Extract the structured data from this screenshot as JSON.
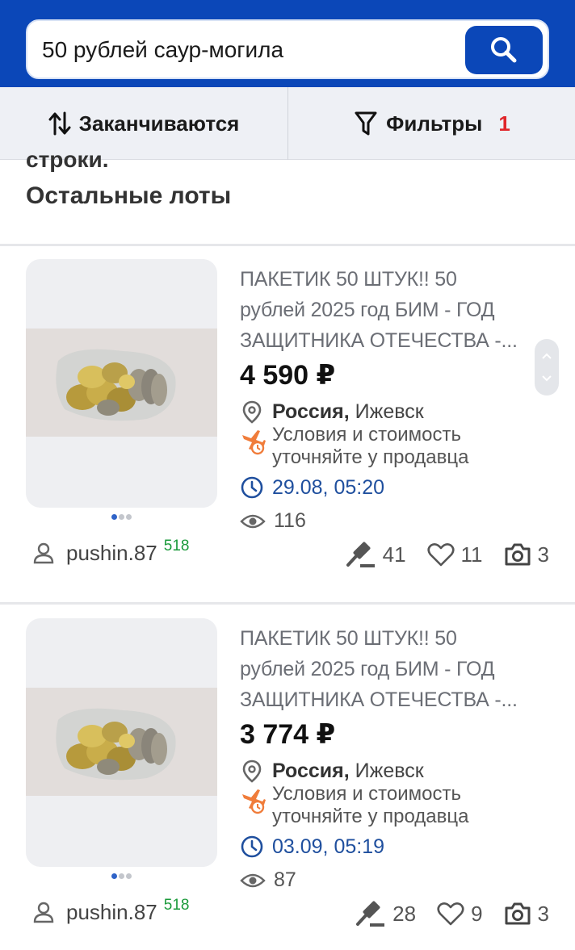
{
  "search": {
    "value": "50 рублей саур-могила"
  },
  "toolbar": {
    "sort_label": "Заканчиваются",
    "filter_label": "Фильтры",
    "filter_count": "1"
  },
  "cut_text": "строки.",
  "section_title": "Остальные лоты",
  "lots": [
    {
      "title_lines": [
        "ПАКЕТИК 50 ШТУК!!      50",
        "рублей 2025 год БИМ - ГОД",
        "ЗАЩИТНИКА ОТЕЧЕСТВА -..."
      ],
      "price": "4 590 ₽",
      "country": "Россия,",
      "city": "Ижевск",
      "shipping_line1": "Условия и стоимость",
      "shipping_line2": "уточняйте у продавца",
      "end_time": "29.08, 05:20",
      "views": "116",
      "seller": "pushin.87",
      "seller_rating": "518",
      "bids": "41",
      "favorites": "11",
      "photos": "3"
    },
    {
      "title_lines": [
        "ПАКЕТИК 50 ШТУК!!      50",
        "рублей 2025 год БИМ - ГОД",
        "ЗАЩИТНИКА ОТЕЧЕСТВА -..."
      ],
      "price": "3 774 ₽",
      "country": "Россия,",
      "city": "Ижевск",
      "shipping_line1": "Условия и стоимость",
      "shipping_line2": "уточняйте у продавца",
      "end_time": "03.09, 05:19",
      "views": "87",
      "seller": "pushin.87",
      "seller_rating": "518",
      "bids": "28",
      "favorites": "9",
      "photos": "3"
    }
  ],
  "colors": {
    "brand_blue": "#0b47b8",
    "badge_red": "#e0262b",
    "rating_green": "#1a9a3a",
    "time_blue": "#1f4f9e",
    "ship_orange": "#f07c3a"
  }
}
